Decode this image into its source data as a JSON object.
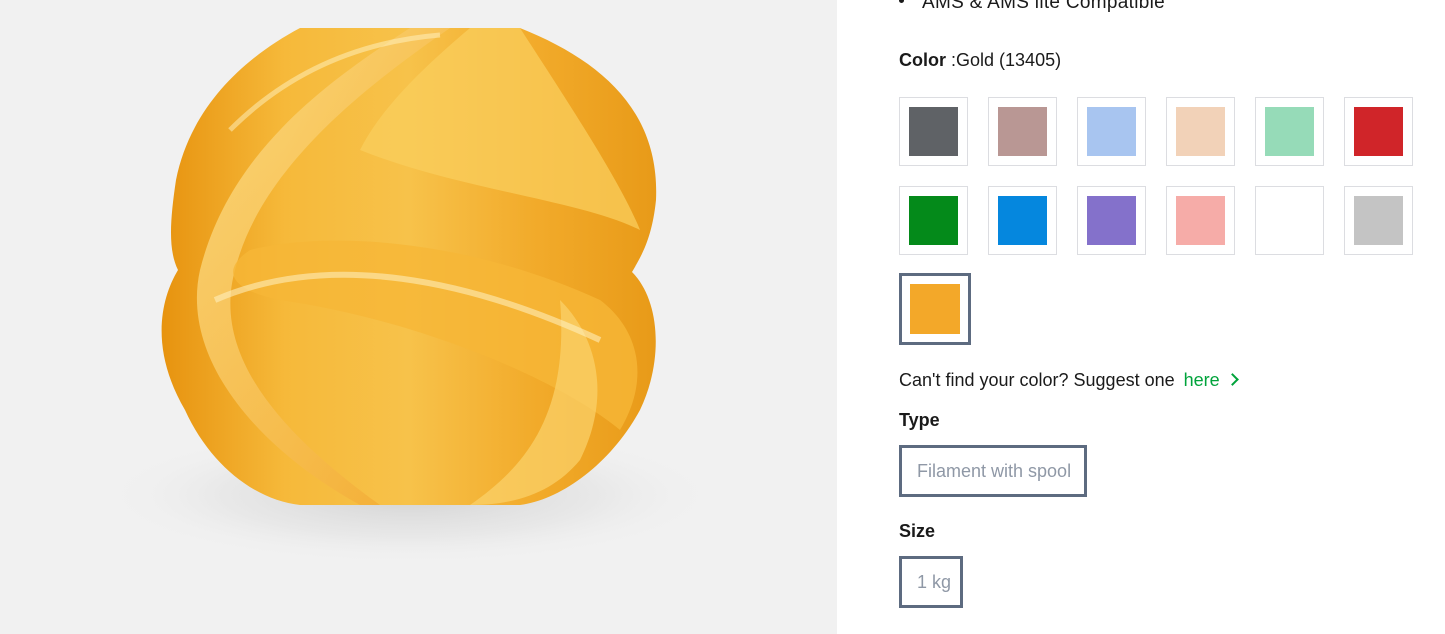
{
  "features": {
    "bullet_text": "AMS & AMS lite Compatible"
  },
  "color": {
    "label": "Color",
    "value": ":Gold (13405)",
    "swatches": [
      {
        "name": "swatch-gray",
        "color": "#5f6266"
      },
      {
        "name": "swatch-mauve",
        "color": "#b99794"
      },
      {
        "name": "swatch-light-blue",
        "color": "#a8c5f0"
      },
      {
        "name": "swatch-beige",
        "color": "#f2d2b8"
      },
      {
        "name": "swatch-mint",
        "color": "#96dbb8"
      },
      {
        "name": "swatch-red",
        "color": "#d02529"
      },
      {
        "name": "swatch-green",
        "color": "#048a1a"
      },
      {
        "name": "swatch-blue",
        "color": "#0587de"
      },
      {
        "name": "swatch-purple",
        "color": "#8471cb"
      },
      {
        "name": "swatch-pink",
        "color": "#f6aca8"
      },
      {
        "name": "swatch-white",
        "color": "#ffffff"
      },
      {
        "name": "swatch-silver",
        "color": "#c4c4c4"
      },
      {
        "name": "swatch-gold",
        "color": "#f3a829",
        "selected": true
      }
    ]
  },
  "suggest": {
    "prefix": "Can't find your color? Suggest one",
    "link": "here",
    "icon": "chevron-right-icon"
  },
  "type": {
    "label": "Type",
    "option": "Filament with spool"
  },
  "size": {
    "label": "Size",
    "option": "1 kg"
  },
  "colors": {
    "link_green": "#00a33b",
    "selected_border": "#5d6b80",
    "product_gold": "#f5b434"
  }
}
